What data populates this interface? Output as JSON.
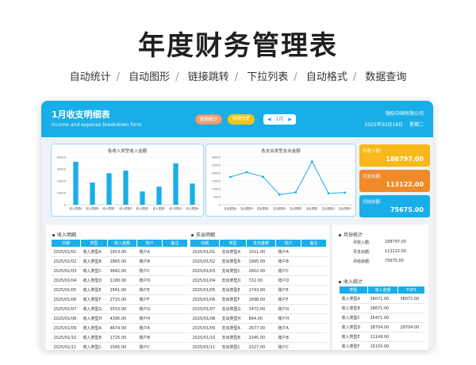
{
  "hero": {
    "title": "年度财务管理表",
    "features": [
      "自动统计",
      "自动图形",
      "链接跳转",
      "下拉列表",
      "自动格式",
      "数据查询"
    ]
  },
  "header": {
    "title": "1月收支明细表",
    "subtitle": "Income and expense breakdown form",
    "btn_summary": "数据统计",
    "btn_yearly": "明细总表",
    "month": "1月",
    "company": "微软中国有限公司",
    "date": "2025年02月18日",
    "weekday": "星期二"
  },
  "colors": {
    "accent": "#1aaee8",
    "income": "#f8b819",
    "expense": "#f08a28",
    "balance": "#1aaee8"
  },
  "kpis": [
    {
      "label": "月收入额:",
      "value": "188797.00"
    },
    {
      "label": "月支出额:",
      "value": "113122.00"
    },
    {
      "label": "月结余额:",
      "value": "75675.00"
    }
  ],
  "chart_data": [
    {
      "type": "bar",
      "title": "各收入类型收入金额",
      "categories": [
        "收入类型A",
        "收入类型B",
        "收入类型C",
        "收入类型D",
        "收入类型E",
        "收入类型F",
        "收入类型G",
        "收入类型H"
      ],
      "values": [
        36071,
        18671,
        26471,
        28704,
        11149,
        15150,
        34800,
        17800
      ],
      "ylim": [
        0,
        40000
      ],
      "yticks": [
        "40000",
        "30000",
        "20000",
        "10000",
        "0"
      ]
    },
    {
      "type": "line",
      "title": "各支出类型支出金额",
      "categories": [
        "支出类型A",
        "支出类型B",
        "支出类型C",
        "支出类型D",
        "支出类型E",
        "支出类型F",
        "支出类型G",
        "支出类型H"
      ],
      "values": [
        17500,
        20500,
        17600,
        6400,
        7800,
        27200,
        7200,
        7600
      ],
      "ylim": [
        0,
        30000
      ],
      "yticks": [
        "30000",
        "25000",
        "20000",
        "15000",
        "10000",
        "5000",
        "0"
      ]
    }
  ],
  "income_table": {
    "title": "收入明细",
    "headers": [
      "日期",
      "类型",
      "收入金额",
      "账户",
      "备注"
    ],
    "rows": [
      [
        "2025/01/01",
        "收入类型A",
        "1653.00",
        "账户A",
        ""
      ],
      [
        "2025/01/02",
        "收入类型B",
        "1865.00",
        "账户B",
        ""
      ],
      [
        "2025/01/03",
        "收入类型C",
        "3842.00",
        "账户C",
        ""
      ],
      [
        "2025/01/04",
        "收入类型D",
        "1180.00",
        "账户D",
        ""
      ],
      [
        "2025/01/05",
        "收入类型E",
        "2561.00",
        "账户E",
        ""
      ],
      [
        "2025/01/06",
        "收入类型F",
        "2715.00",
        "账户F",
        ""
      ],
      [
        "2025/01/07",
        "收入类型G",
        "3553.00",
        "账户G",
        ""
      ],
      [
        "2025/01/08",
        "收入类型H",
        "4395.00",
        "账户H",
        ""
      ],
      [
        "2025/01/09",
        "收入类型A",
        "4674.00",
        "账户A",
        ""
      ],
      [
        "2025/01/10",
        "收入类型B",
        "1725.00",
        "账户B",
        ""
      ],
      [
        "2025/01/11",
        "收入类型C",
        "1585.00",
        "账户C",
        ""
      ]
    ]
  },
  "expense_table": {
    "title": "支出明细",
    "headers": [
      "日期",
      "类型",
      "支出金额",
      "账户",
      "备注"
    ],
    "rows": [
      [
        "2025/01/01",
        "支出类型A",
        "1011.00",
        "账户A",
        ""
      ],
      [
        "2025/01/02",
        "支出类型B",
        "1995.00",
        "账户B",
        ""
      ],
      [
        "2025/01/03",
        "支出类型C",
        "2602.00",
        "账户C",
        ""
      ],
      [
        "2025/01/04",
        "支出类型D",
        "722.00",
        "账户D",
        ""
      ],
      [
        "2025/01/05",
        "支出类型E",
        "1743.00",
        "账户E",
        ""
      ],
      [
        "2025/01/06",
        "支出类型F",
        "1698.00",
        "账户F",
        ""
      ],
      [
        "2025/01/07",
        "支出类型G",
        "1472.00",
        "账户G",
        ""
      ],
      [
        "2025/01/08",
        "支出类型H",
        "894.00",
        "账户H",
        ""
      ],
      [
        "2025/01/09",
        "支出类型A",
        "2677.00",
        "账户A",
        ""
      ],
      [
        "2025/01/10",
        "支出类型B",
        "2345.00",
        "账户B",
        ""
      ],
      [
        "2025/01/11",
        "支出类型C",
        "2327.00",
        "账户C",
        ""
      ]
    ]
  },
  "month_stats": {
    "title": "月份统计",
    "rows": [
      {
        "label": "月收入额:",
        "value": "188797.00"
      },
      {
        "label": "月支出额:",
        "value": "113122.00"
      },
      {
        "label": "月结余额:",
        "value": "75675.00"
      }
    ]
  },
  "income_stats": {
    "title": "收入统计",
    "headers": [
      "类型",
      "收入金额",
      "TOP1"
    ],
    "rows": [
      [
        "收入类型A",
        "36071.00",
        "36071.00"
      ],
      [
        "收入类型B",
        "18671.00",
        ""
      ],
      [
        "收入类型C",
        "26471.00",
        ""
      ],
      [
        "收入类型D",
        "28704.00",
        "28704.00"
      ],
      [
        "收入类型E",
        "11149.00",
        ""
      ],
      [
        "收入类型F",
        "15150.00",
        ""
      ]
    ]
  }
}
